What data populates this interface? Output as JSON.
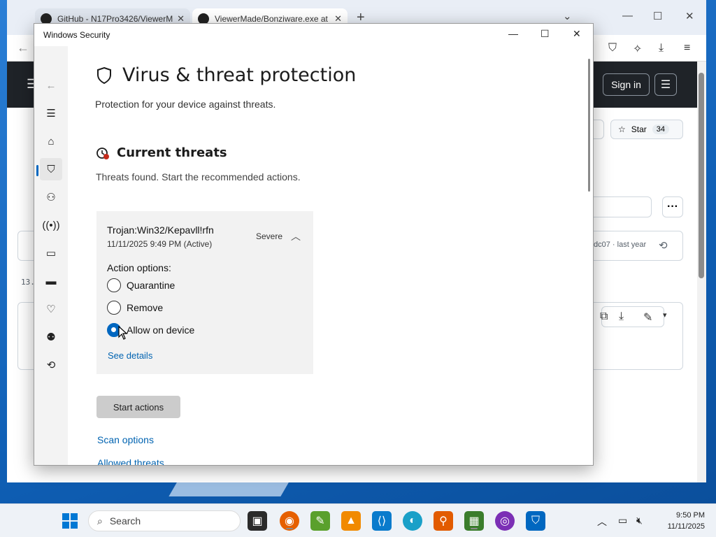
{
  "browser": {
    "tabs": [
      {
        "label": "GitHub - N17Pro3426/ViewerM"
      },
      {
        "label": "ViewerMade/Bonziware.exe at"
      }
    ],
    "github": {
      "sign_in": "Sign in",
      "star_label": "Star",
      "star_count": "34",
      "commit_text": "dc07 · last year",
      "line_number": "13."
    }
  },
  "security": {
    "window_title": "Windows Security",
    "page_title": "Virus & threat protection",
    "page_subtitle": "Protection for your device against threats.",
    "section_title": "Current threats",
    "section_subtitle": "Threats found. Start the recommended actions.",
    "threat": {
      "name": "Trojan:Win32/Kepavll!rfn",
      "date": "11/11/2025 9:49 PM (Active)",
      "severity": "Severe",
      "action_options_label": "Action options:",
      "options": [
        {
          "label": "Quarantine",
          "selected": false
        },
        {
          "label": "Remove",
          "selected": false
        },
        {
          "label": "Allow on device",
          "selected": true
        }
      ],
      "see_details": "See details"
    },
    "start_actions": "Start actions",
    "links": {
      "scan_options": "Scan options",
      "allowed_threats": "Allowed threats"
    },
    "accent_color": "#0067c0"
  },
  "taskbar": {
    "search_label": "Search",
    "clock_time": "9:50 PM",
    "clock_date": "11/11/2025"
  }
}
